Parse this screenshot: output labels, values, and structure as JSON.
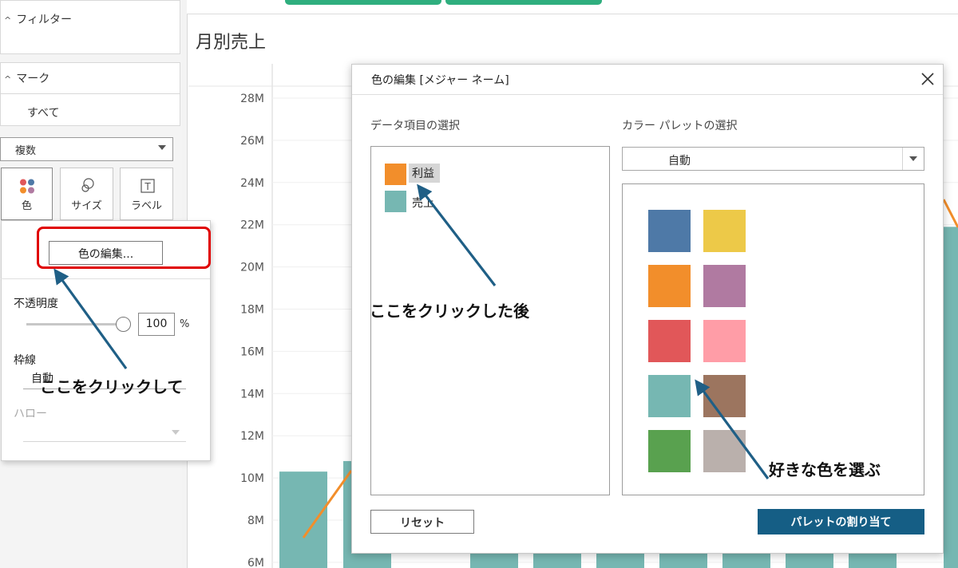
{
  "shelf": {
    "filters_label": "フィルター",
    "marks_label": "マーク",
    "marks_all": "すべて",
    "mark_type": "複数",
    "mark_buttons": [
      "色",
      "サイズ",
      "ラベル"
    ]
  },
  "color_popup": {
    "edit_colors_button": "色の編集...",
    "opacity_label": "不透明度",
    "opacity_value": "100",
    "opacity_unit": "%",
    "opacity_fraction": 1.0,
    "border_label": "枠線",
    "border_value": "自動",
    "halo_label": "ハロー"
  },
  "worksheet": {
    "title": "月別売上"
  },
  "chart_data": {
    "type": "bar",
    "ylim": [
      6,
      28
    ],
    "ytick_values": [
      6,
      8,
      10,
      12,
      14,
      16,
      18,
      20,
      22,
      24,
      26,
      28
    ],
    "ytick_labels": [
      "6M",
      "8M",
      "10M",
      "12M",
      "14M",
      "16M",
      "18M",
      "20M",
      "22M",
      "24M",
      "26M",
      "28M"
    ],
    "values": [
      10.3,
      10.8,
      null,
      null,
      null,
      null,
      null,
      null,
      null,
      null,
      null,
      21.9
    ],
    "line": {
      "name": "利益",
      "color": "#f28e2b"
    },
    "bar_color": "#76b7b2"
  },
  "dialog": {
    "title": "色の編集 [メジャー ネーム]",
    "data_items_label": "データ項目の選択",
    "palette_label": "カラー パレットの選択",
    "palette_value": "自動",
    "items": [
      {
        "label": "利益",
        "color": "#f28e2b"
      },
      {
        "label": "売上",
        "color": "#76b7b2"
      }
    ],
    "palette": [
      {
        "name": "blue",
        "color": "#4e79a7"
      },
      {
        "name": "yellow",
        "color": "#edc948"
      },
      {
        "name": "orange",
        "color": "#f28e2b"
      },
      {
        "name": "purple",
        "color": "#b07aa1"
      },
      {
        "name": "red",
        "color": "#e15759"
      },
      {
        "name": "pink",
        "color": "#ff9da7"
      },
      {
        "name": "teal",
        "color": "#76b7b2"
      },
      {
        "name": "brown",
        "color": "#9c755f"
      },
      {
        "name": "green",
        "color": "#59a14f"
      },
      {
        "name": "gray",
        "color": "#bab0ac"
      }
    ],
    "reset_button": "リセット",
    "assign_button": "パレットの割り当て"
  },
  "annotations": {
    "click_here_then": "ここをクリックして",
    "after_click_here": "ここをクリックした後",
    "choose_favorite_color": "好きな色を選ぶ"
  },
  "colors": {
    "accent_button": "#155e85",
    "annotation_arrow": "#1f5f86",
    "highlight_frame": "#e00000",
    "tab_green": "#2fae7e"
  }
}
